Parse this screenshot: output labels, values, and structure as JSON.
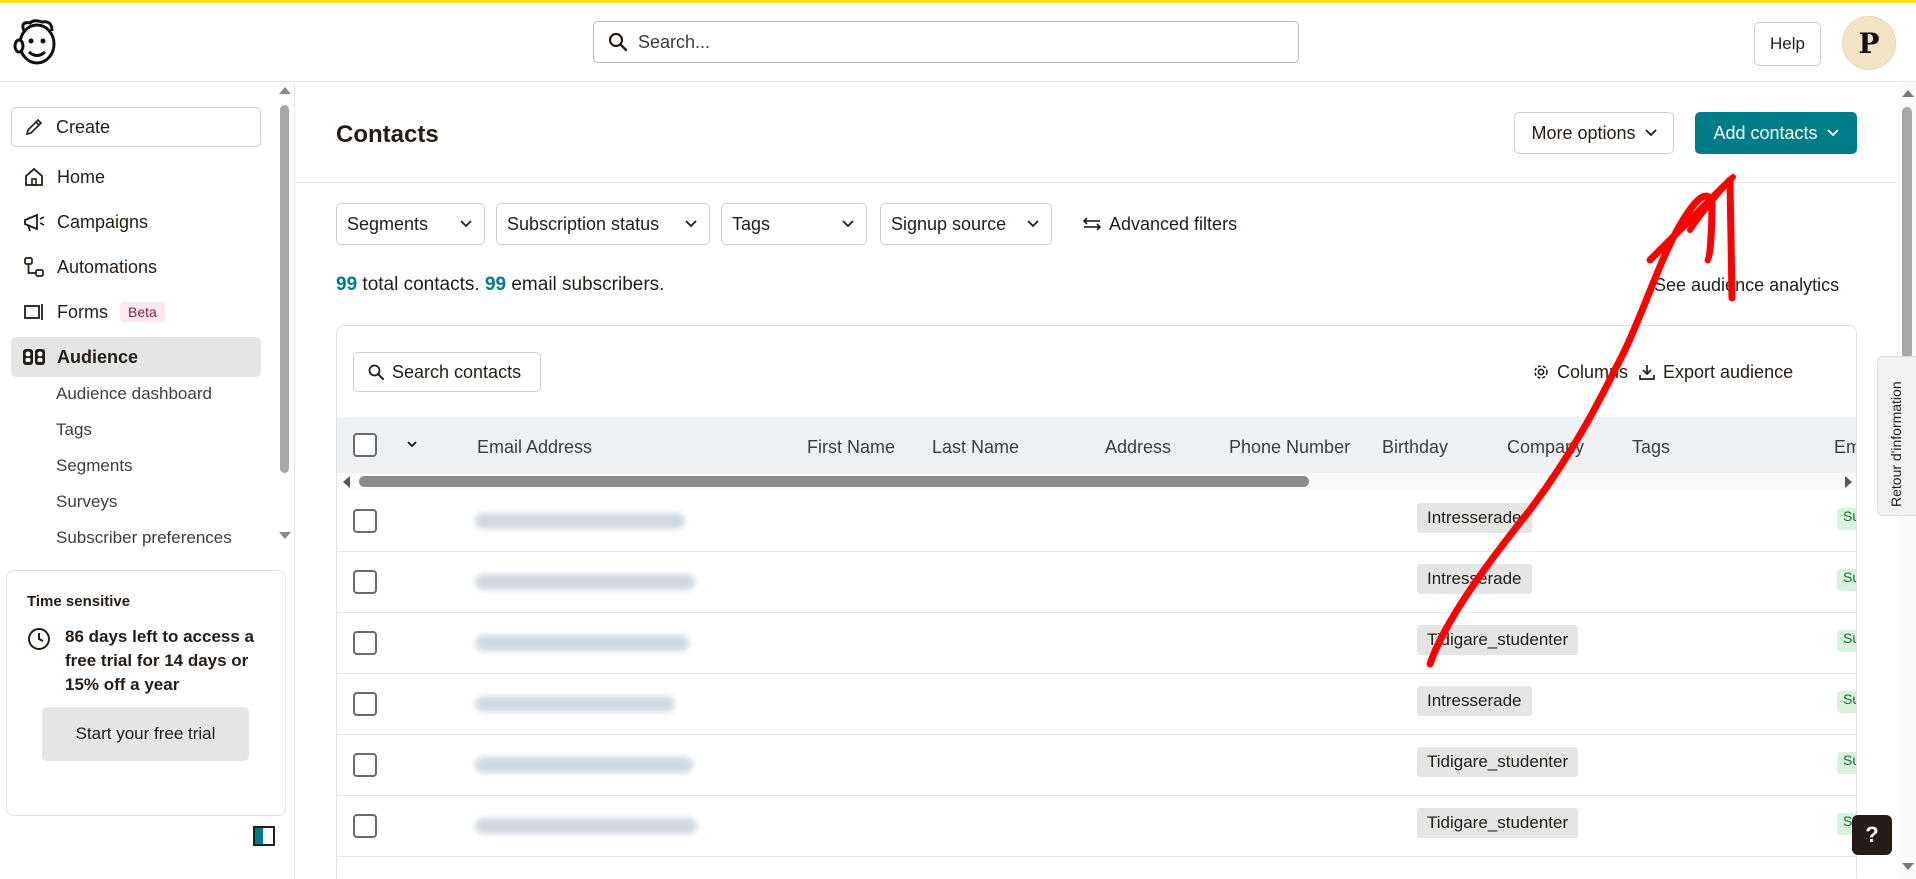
{
  "header": {
    "search_placeholder": "Search...",
    "help_label": "Help",
    "avatar_initial": "P"
  },
  "sidebar": {
    "create_label": "Create",
    "nav": [
      {
        "label": "Home",
        "icon": "home-icon"
      },
      {
        "label": "Campaigns",
        "icon": "megaphone-icon"
      },
      {
        "label": "Automations",
        "icon": "automation-flow-icon"
      },
      {
        "label": "Forms",
        "icon": "form-icon",
        "badge": "Beta"
      },
      {
        "label": "Audience",
        "icon": "audience-icon",
        "active": true
      }
    ],
    "audience_subnav": [
      "Audience dashboard",
      "Tags",
      "Segments",
      "Surveys",
      "Subscriber preferences"
    ],
    "promo": {
      "title": "Time sensitive",
      "message": "86 days left to access a free trial for 14 days or 15% off a year",
      "button_label": "Start your free trial"
    }
  },
  "main": {
    "title": "Contacts",
    "more_options_label": "More options",
    "add_contacts_label": "Add contacts",
    "filters": [
      "Segments",
      "Subscription status",
      "Tags",
      "Signup source"
    ],
    "advanced_filters_label": "Advanced filters",
    "totals": {
      "total_count": "99",
      "total_text": "total contacts.",
      "email_count": "99",
      "email_text": "email subscribers."
    },
    "analytics_link": "See audience analytics",
    "table": {
      "search_label": "Search contacts",
      "columns_label": "Columns",
      "export_label": "Export audience",
      "headers": [
        "Email Address",
        "First Name",
        "Last Name",
        "Address",
        "Phone Number",
        "Birthday",
        "Company",
        "Tags",
        "Em"
      ],
      "rows": [
        {
          "tag": "Intresserade",
          "status": "Su"
        },
        {
          "tag": "Intresserade",
          "status": "Su"
        },
        {
          "tag": "Tidigare_studenter",
          "status": "Su"
        },
        {
          "tag": "Intresserade",
          "status": "Su"
        },
        {
          "tag": "Tidigare_studenter",
          "status": "Su"
        },
        {
          "tag": "Tidigare_studenter",
          "status": "Su"
        }
      ]
    }
  },
  "feedback_tab_label": "Retour d'information",
  "help_float_label": "?",
  "colors": {
    "accent": "#007c89",
    "brand_yellow": "#ffe01b",
    "annotation_red": "#ff0000"
  }
}
